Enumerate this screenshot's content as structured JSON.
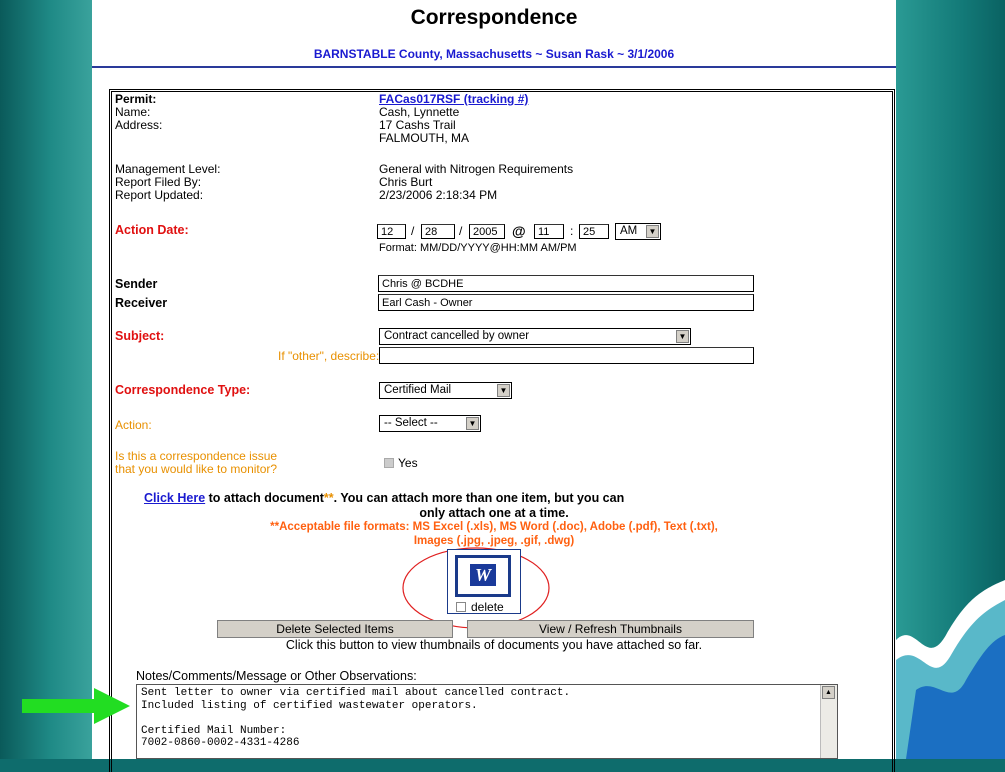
{
  "header": {
    "title": "Correspondence",
    "subtitle": "BARNSTABLE County, Massachusetts ~ Susan Rask ~ 3/1/2006"
  },
  "info": {
    "permit_label": "Permit:",
    "permit_value": "FACas017RSF (tracking #)",
    "name_label": "Name:",
    "name_value": "Cash, Lynnette",
    "address_label": "Address:",
    "address_line1": "17 Cashs Trail",
    "address_line2": "FALMOUTH, MA",
    "mgmt_label": "Management Level:",
    "mgmt_value": "General with Nitrogen Requirements",
    "filed_label": "Report Filed By:",
    "filed_value": "Chris Burt",
    "updated_label": "Report Updated:",
    "updated_value": "2/23/2006 2:18:34 PM"
  },
  "action_date": {
    "label": "Action Date:",
    "month": "12",
    "day": "28",
    "year": "2005",
    "sep1": "/",
    "sep2": "/",
    "at": "@",
    "hour": "11",
    "colon": ":",
    "minute": "25",
    "ampm": "AM",
    "format": "Format: MM/DD/YYYY@HH:MM AM/PM"
  },
  "sender": {
    "label": "Sender",
    "value": "Chris @ BCDHE"
  },
  "receiver": {
    "label": "Receiver",
    "value": "Earl Cash - Owner"
  },
  "subject": {
    "label": "Subject:",
    "value": "Contract cancelled by owner",
    "other_label": "If \"other\", describe:",
    "other_value": ""
  },
  "corr_type": {
    "label": "Correspondence Type:",
    "value": "Certified Mail"
  },
  "action": {
    "label": "Action:",
    "value": "-- Select --"
  },
  "monitor": {
    "label_line1": "Is this a correspondence issue",
    "label_line2": "that you would like to monitor?",
    "option": "Yes"
  },
  "attach": {
    "link": "Click Here",
    "text1": " to attach document",
    "star": "**",
    "text2": ". You can attach more than one item, but you can",
    "text3": "only attach one at a time.",
    "formats1": "**Acceptable file formats: MS Excel (.xls), MS Word (.doc), Adobe (.pdf), Text (.txt),",
    "formats2": "Images (.jpg, .jpeg, .gif, .dwg)",
    "thumb_letter": "W",
    "delete_label": "delete"
  },
  "buttons": {
    "delete_selected": "Delete Selected Items",
    "view_refresh": "View / Refresh Thumbnails",
    "hint": "Click this button to view thumbnails of documents you have attached so far."
  },
  "notes": {
    "label": "Notes/Comments/Message or Other Observations:",
    "text": "Sent letter to owner via certified mail about cancelled contract.\nIncluded listing of certified wastewater operators.\n\nCertified Mail Number:\n7002-0860-0002-4331-4286"
  },
  "colors": {
    "accent_red": "#e01010",
    "link_blue": "#1a1ad0",
    "note_orange": "#e89000",
    "arrow_green": "#22dd22",
    "circle_red": "#e02020"
  }
}
